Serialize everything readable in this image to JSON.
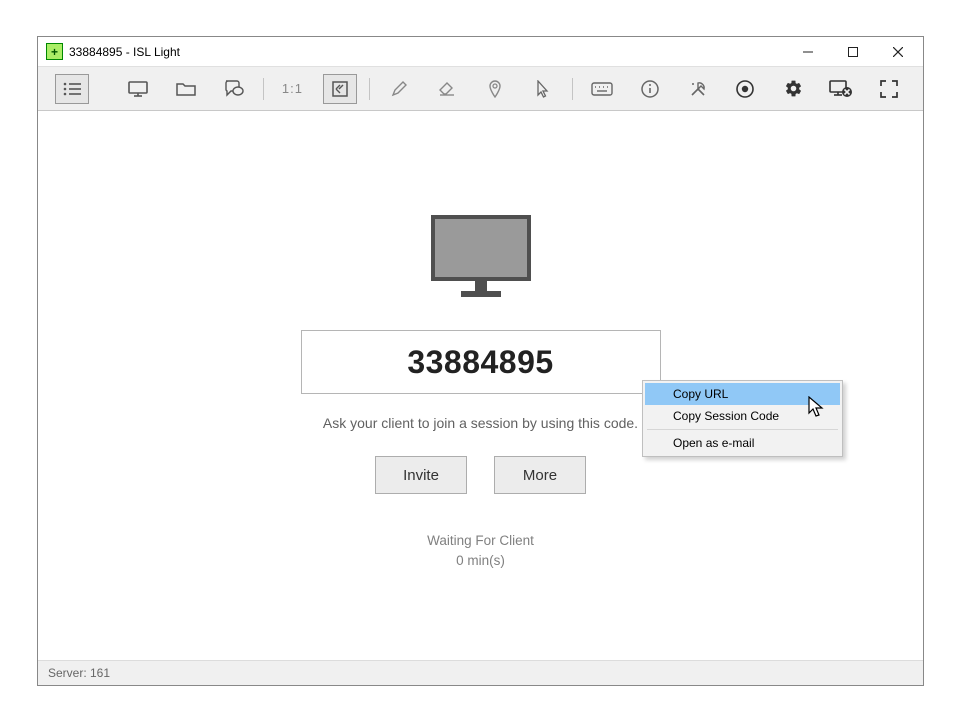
{
  "window": {
    "title": "33884895 - ISL Light"
  },
  "toolbar": {
    "items": [
      {
        "name": "list-icon",
        "selected": true
      },
      {
        "name": "monitor-icon"
      },
      {
        "name": "folder-icon"
      },
      {
        "name": "chat-icon"
      },
      {
        "sep": true
      },
      {
        "name": "zoom-1to1-icon",
        "text": "1:1"
      },
      {
        "name": "fit-icon",
        "selected": true
      },
      {
        "sep": true
      },
      {
        "name": "pencil-icon"
      },
      {
        "name": "eraser-icon"
      },
      {
        "name": "marker-pin-icon"
      },
      {
        "name": "pointer-icon"
      },
      {
        "sep": true
      },
      {
        "name": "keyboard-icon"
      },
      {
        "name": "info-icon"
      },
      {
        "name": "tools-icon"
      },
      {
        "name": "record-icon"
      },
      {
        "name": "gear-icon"
      },
      {
        "name": "end-session-icon"
      },
      {
        "name": "fullscreen-icon"
      }
    ]
  },
  "session": {
    "code": "33884895",
    "instruction": "Ask your client to join a session by using this code.",
    "invite_label": "Invite",
    "more_label": "More",
    "waiting_label": "Waiting For Client",
    "duration_label": "0 min(s)"
  },
  "context_menu": {
    "items": [
      {
        "label": "Copy URL",
        "hover": true
      },
      {
        "label": "Copy Session Code"
      },
      {
        "sep": true
      },
      {
        "label": "Open as e-mail"
      }
    ]
  },
  "statusbar": {
    "server_label": "Server: 161"
  }
}
